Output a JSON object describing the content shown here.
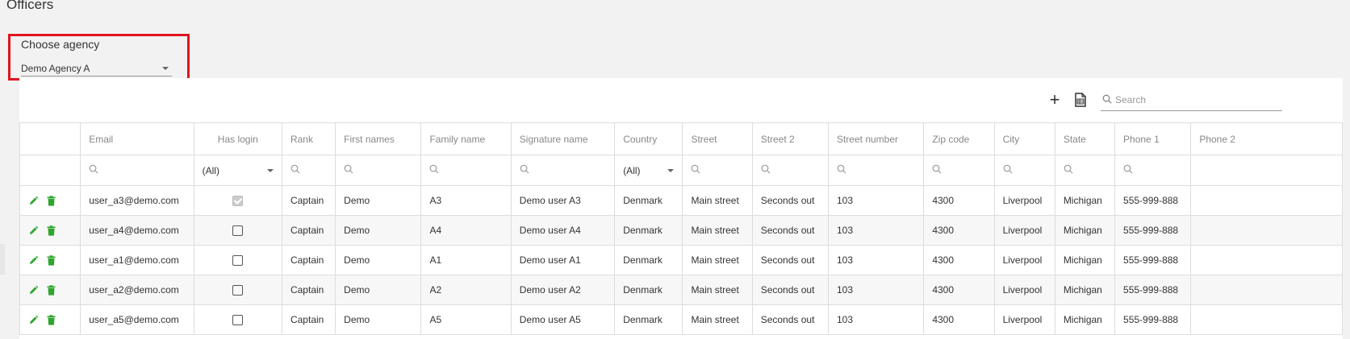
{
  "page": {
    "title": "Officers"
  },
  "agency": {
    "label": "Choose agency",
    "value": "Demo Agency A"
  },
  "toolbar": {
    "add_label": "+",
    "search_placeholder": "Search"
  },
  "colors": {
    "accent_green": "#2fa52f",
    "highlight_red": "#e0141e"
  },
  "icons": {
    "edit": "pencil-icon",
    "delete": "trash-icon",
    "add": "plus-icon",
    "export": "export-excel-icon",
    "search": "search-icon"
  },
  "table": {
    "headers": [
      "",
      "Email",
      "Has login",
      "Rank",
      "First names",
      "Family name",
      "Signature name",
      "Country",
      "Street",
      "Street 2",
      "Street number",
      "Zip code",
      "City",
      "State",
      "Phone 1",
      "Phone 2"
    ],
    "filters": {
      "has_login": "(All)",
      "country": "(All)"
    },
    "rows": [
      {
        "email": "user_a3@demo.com",
        "has_login": true,
        "rank": "Captain",
        "first": "Demo",
        "family": "A3",
        "signature": "Demo user A3",
        "country": "Denmark",
        "street": "Main street",
        "street2": "Seconds out",
        "number": "103",
        "zip": "4300",
        "city": "Liverpool",
        "state": "Michigan",
        "phone1": "555-999-888",
        "phone2": ""
      },
      {
        "email": "user_a4@demo.com",
        "has_login": false,
        "rank": "Captain",
        "first": "Demo",
        "family": "A4",
        "signature": "Demo user A4",
        "country": "Denmark",
        "street": "Main street",
        "street2": "Seconds out",
        "number": "103",
        "zip": "4300",
        "city": "Liverpool",
        "state": "Michigan",
        "phone1": "555-999-888",
        "phone2": ""
      },
      {
        "email": "user_a1@demo.com",
        "has_login": false,
        "rank": "Captain",
        "first": "Demo",
        "family": "A1",
        "signature": "Demo user A1",
        "country": "Denmark",
        "street": "Main street",
        "street2": "Seconds out",
        "number": "103",
        "zip": "4300",
        "city": "Liverpool",
        "state": "Michigan",
        "phone1": "555-999-888",
        "phone2": ""
      },
      {
        "email": "user_a2@demo.com",
        "has_login": false,
        "rank": "Captain",
        "first": "Demo",
        "family": "A2",
        "signature": "Demo user A2",
        "country": "Denmark",
        "street": "Main street",
        "street2": "Seconds out",
        "number": "103",
        "zip": "4300",
        "city": "Liverpool",
        "state": "Michigan",
        "phone1": "555-999-888",
        "phone2": ""
      },
      {
        "email": "user_a5@demo.com",
        "has_login": false,
        "rank": "Captain",
        "first": "Demo",
        "family": "A5",
        "signature": "Demo user A5",
        "country": "Denmark",
        "street": "Main street",
        "street2": "Seconds out",
        "number": "103",
        "zip": "4300",
        "city": "Liverpool",
        "state": "Michigan",
        "phone1": "555-999-888",
        "phone2": ""
      }
    ]
  }
}
